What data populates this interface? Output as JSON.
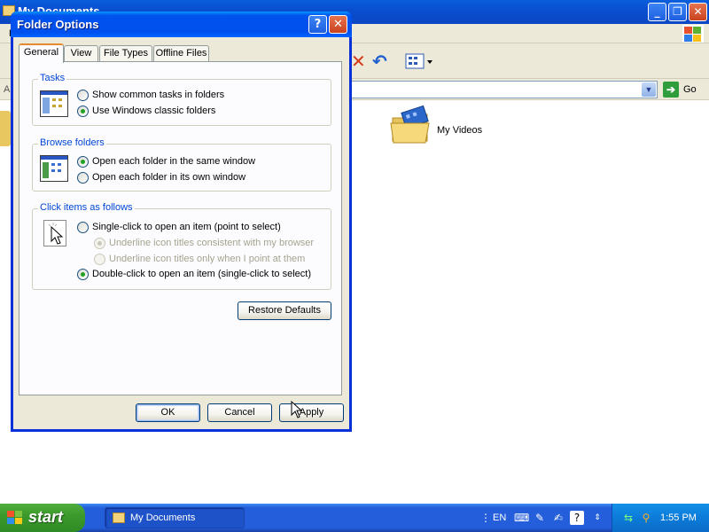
{
  "background_window": {
    "title": "My Documents",
    "menu_first_letter": "F",
    "address_label": "A",
    "go_label": "Go",
    "items": [
      {
        "label": "My Videos",
        "icon": "folder-video-icon"
      }
    ]
  },
  "dialog": {
    "title": "Folder Options",
    "help_glyph": "?",
    "close_glyph": "✕",
    "tabs": [
      {
        "label": "General",
        "active": true
      },
      {
        "label": "View",
        "active": false
      },
      {
        "label": "File Types",
        "active": false
      },
      {
        "label": "Offline Files",
        "active": false
      }
    ],
    "tasks": {
      "title": "Tasks",
      "options": [
        {
          "label": "Show common tasks in folders",
          "checked": false,
          "disabled": false
        },
        {
          "label": "Use Windows classic folders",
          "checked": true,
          "disabled": false
        }
      ]
    },
    "browse": {
      "title": "Browse folders",
      "options": [
        {
          "label": "Open each folder in the same window",
          "checked": true,
          "disabled": false
        },
        {
          "label": "Open each folder in its own window",
          "checked": false,
          "disabled": false
        }
      ]
    },
    "click": {
      "title": "Click items as follows",
      "options": [
        {
          "label": "Single-click to open an item (point to select)",
          "checked": false,
          "disabled": false
        },
        {
          "label": "Underline icon titles consistent with my browser",
          "checked": true,
          "disabled": true
        },
        {
          "label": "Underline icon titles only when I point at them",
          "checked": false,
          "disabled": true
        },
        {
          "label": "Double-click to open an item (single-click to select)",
          "checked": true,
          "disabled": false
        }
      ]
    },
    "restore_defaults_label": "Restore Defaults",
    "ok_label": "OK",
    "cancel_label": "Cancel",
    "apply_label": "Apply"
  },
  "taskbar": {
    "start_label": "start",
    "task_button_label": "My Documents",
    "language": "EN",
    "clock": "1:55 PM"
  },
  "colors": {
    "titlebar_blue": "#0053ee",
    "group_title_blue": "#0046d5",
    "radio_checked_green": "#21a121",
    "taskbar_blue": "#245edb",
    "start_green": "#3c9a2c",
    "active_tab_orange": "#e68b2c"
  }
}
